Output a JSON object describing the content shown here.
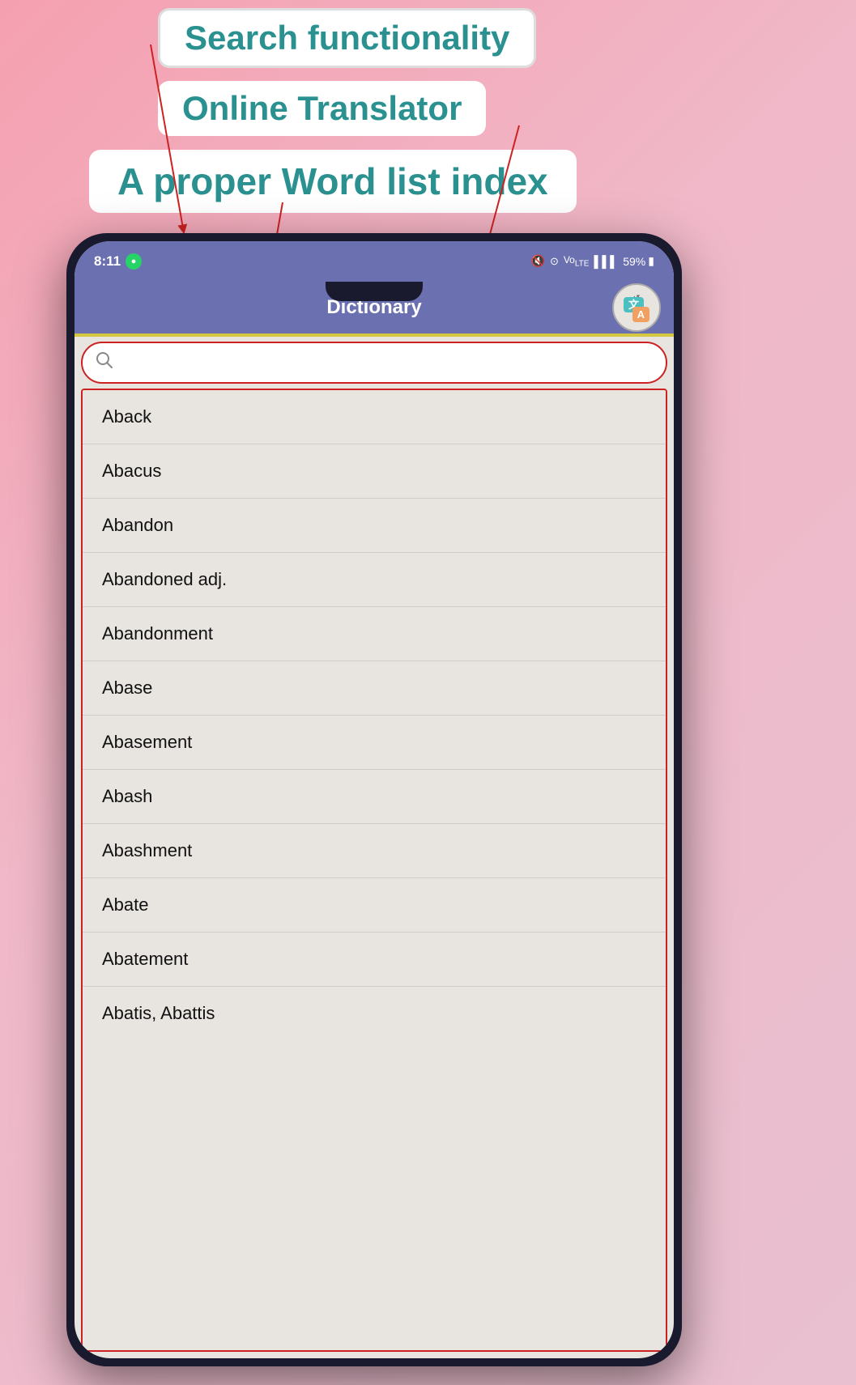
{
  "annotations": {
    "search_label": "Search functionality",
    "translator_label": "Online Translator",
    "wordlist_label": "A proper Word list index"
  },
  "phone": {
    "status_bar": {
      "time": "8:11",
      "battery": "59%",
      "whatsapp_symbol": "W"
    },
    "header": {
      "title": "Dictionary",
      "translate_zh": "文",
      "translate_a": "A"
    },
    "search": {
      "placeholder": ""
    },
    "words": [
      "Aback",
      "Abacus",
      "Abandon",
      "Abandoned adj.",
      "Abandonment",
      "Abase",
      "Abasement",
      "Abash",
      "Abashment",
      "Abate",
      "Abatement",
      "Abatis, Abattis"
    ]
  }
}
